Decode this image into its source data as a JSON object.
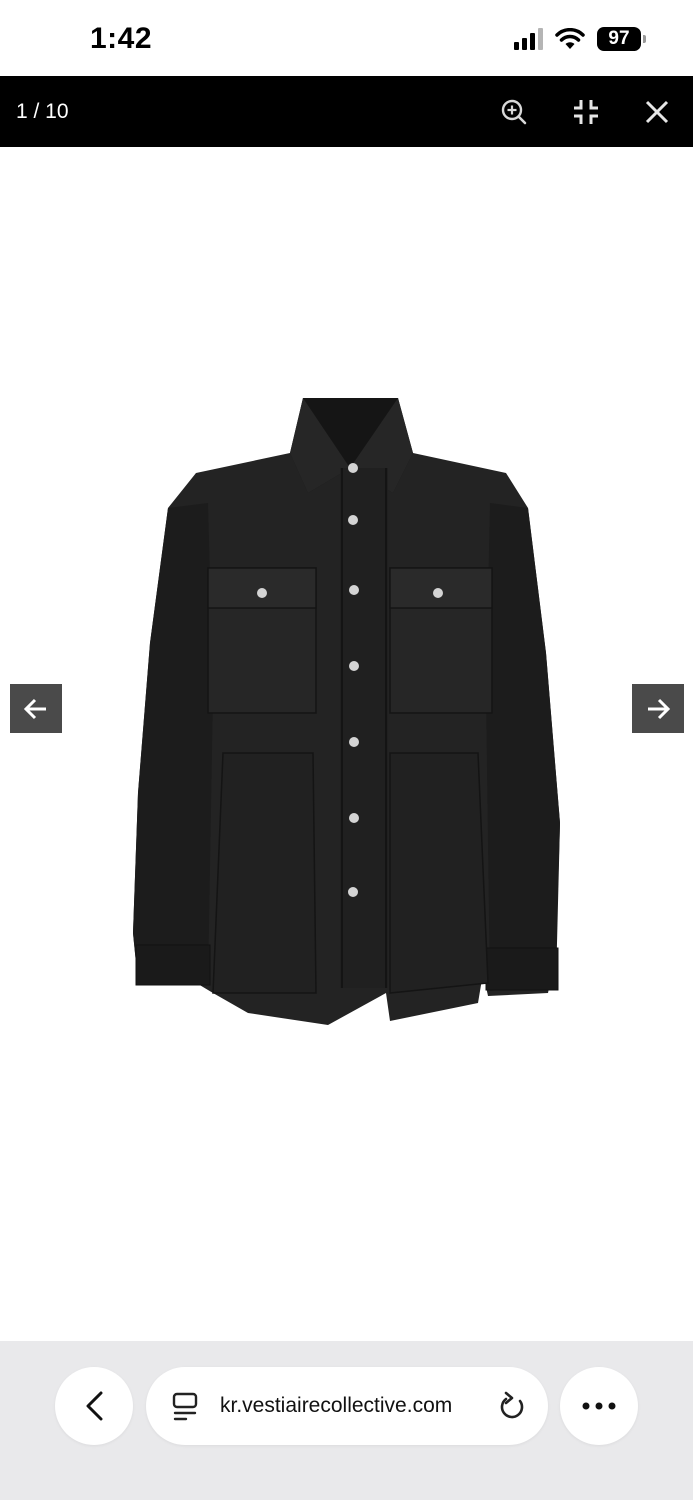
{
  "status_bar": {
    "time": "1:42",
    "battery": "97"
  },
  "viewer": {
    "counter": "1 / 10",
    "icons": [
      "zoom-in-icon",
      "shrink-icon",
      "close-icon"
    ]
  },
  "gallery": {
    "prev_icon": "arrow-left-icon",
    "next_icon": "arrow-right-icon",
    "image_subject": "black snap-button shirt jacket"
  },
  "browser": {
    "url": "kr.vestiairecollective.com",
    "icons": [
      "back-chevron-icon",
      "tabs-icon",
      "reload-icon",
      "more-icon"
    ]
  },
  "colors": {
    "viewer_bar": "#000000",
    "arrow_bg": "#4a4a4a",
    "browser_bar": "#e9e9eb"
  }
}
